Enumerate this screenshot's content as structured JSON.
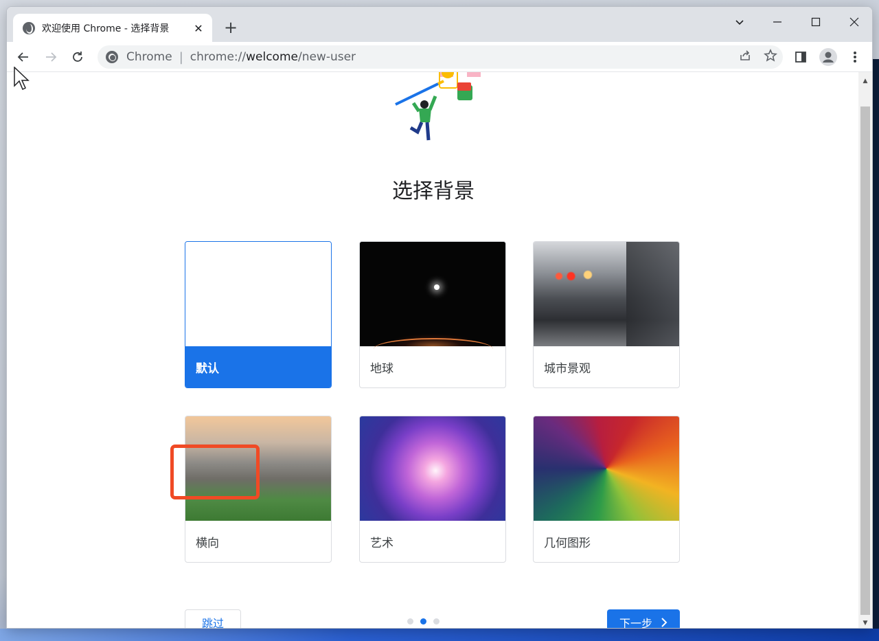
{
  "browser": {
    "tab_title": "欢迎使用 Chrome - 选择背景",
    "tab_close": "✕",
    "new_tab": "+",
    "omnibox": {
      "site_label": "Chrome",
      "url_prefix": "chrome://",
      "url_host": "welcome",
      "url_path": "/new-user"
    }
  },
  "page": {
    "title": "选择背景",
    "backgrounds": [
      {
        "label": "默认",
        "selected": true
      },
      {
        "label": "地球",
        "selected": false
      },
      {
        "label": "城市景观",
        "selected": false
      },
      {
        "label": "横向",
        "selected": false
      },
      {
        "label": "艺术",
        "selected": false
      },
      {
        "label": "几何图形",
        "selected": false
      }
    ],
    "skip_label": "跳过",
    "next_label": "下一步",
    "pagination": {
      "total": 3,
      "current": 2
    }
  },
  "colors": {
    "accent": "#1a73e8",
    "highlight": "#f04a25"
  }
}
